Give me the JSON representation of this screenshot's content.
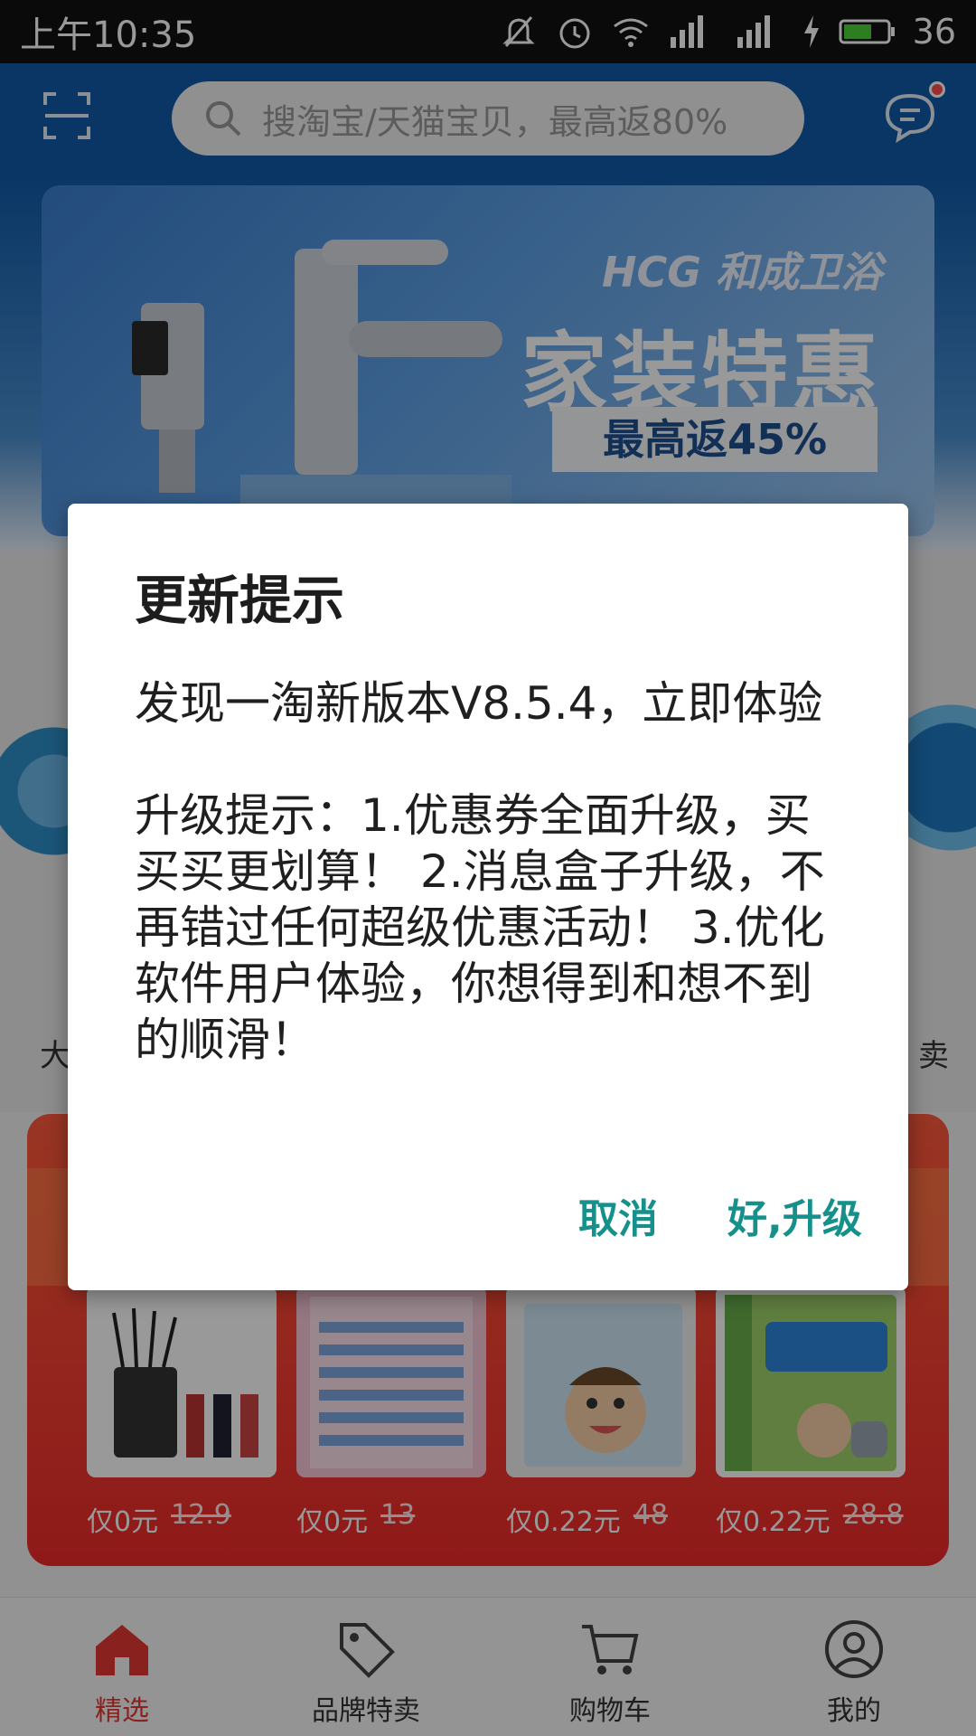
{
  "status_bar": {
    "time": "上午10:35",
    "battery_level": "36",
    "icons": [
      "mute-icon",
      "alarm-icon",
      "wifi-icon",
      "4g-signal-icon",
      "signal-icon",
      "charging-icon",
      "battery-icon"
    ]
  },
  "header": {
    "search_placeholder": "搜淘宝/天猫宝贝，最高返80%"
  },
  "banner": {
    "brand": "HCG 和成卫浴",
    "headline": "家装特惠",
    "tag": "最高返45%"
  },
  "background_fragments": {
    "left_char": "大",
    "right_char": "卖"
  },
  "products": [
    {
      "price": "仅0元",
      "original": "12.9"
    },
    {
      "price": "仅0元",
      "original": "13"
    },
    {
      "price": "仅0.22元",
      "original": "48"
    },
    {
      "price": "仅0.22元",
      "original": "28.8"
    }
  ],
  "bottom_nav": [
    {
      "label": "精选",
      "icon": "home-icon",
      "active": true
    },
    {
      "label": "品牌特卖",
      "icon": "tag-icon",
      "active": false
    },
    {
      "label": "购物车",
      "icon": "cart-icon",
      "active": false
    },
    {
      "label": "我的",
      "icon": "profile-icon",
      "active": false
    }
  ],
  "dialog": {
    "title": "更新提示",
    "message": "发现一淘新版本V8.5.4，立即体验\n\n升级提示：1.优惠券全面升级，买买买更划算！ 2.消息盒子升级，不再错过任何超级优惠活动！ 3.优化软件用户体验，你想得到和想不到的顺滑！",
    "cancel_label": "取消",
    "confirm_label": "好,升级"
  },
  "colors": {
    "accent": "#16908a",
    "nav_active": "#e53935",
    "header_blue": "#0f5aa8",
    "promo_red": "#ee2a2a"
  }
}
